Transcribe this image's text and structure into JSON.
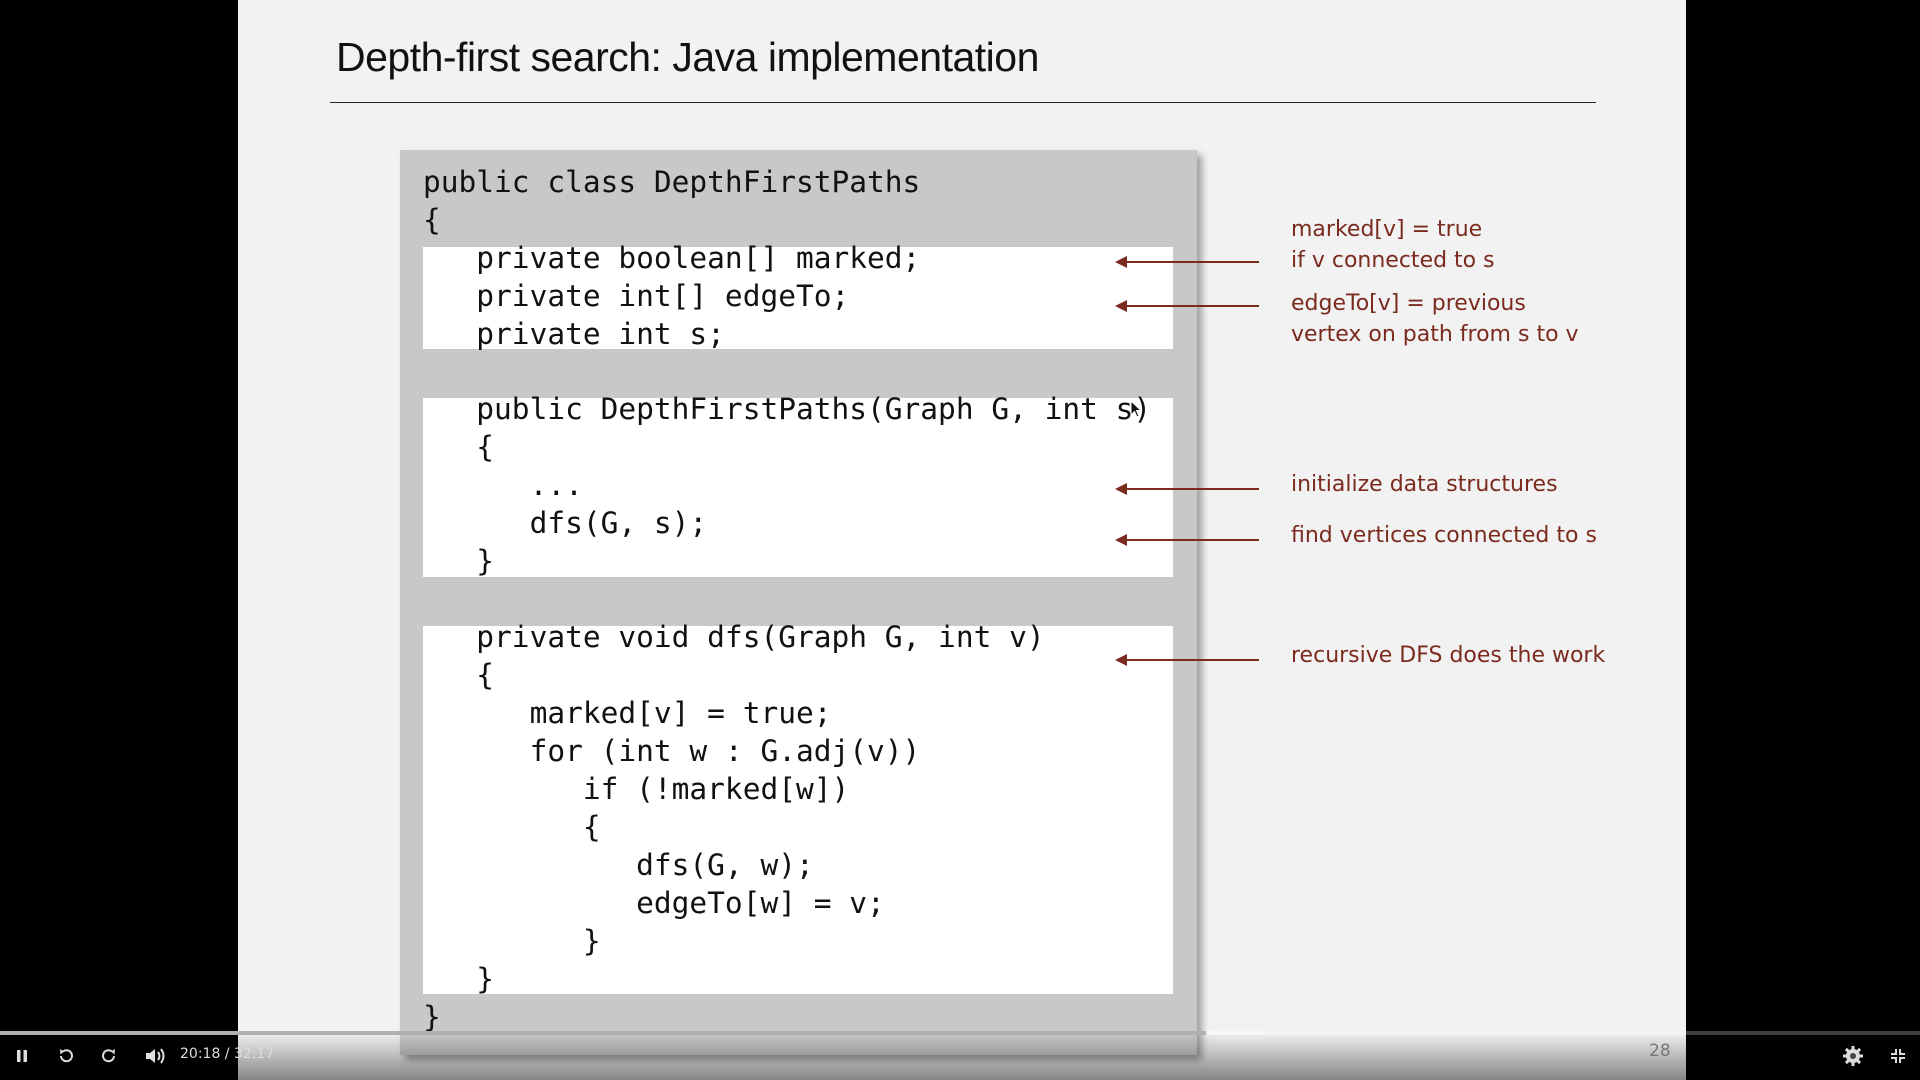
{
  "slide": {
    "title": "Depth-first search:  Java implementation",
    "page_number": "28"
  },
  "code": {
    "lines": [
      "public class DepthFirstPaths",
      "{",
      "   private boolean[] marked;",
      "   private int[] edgeTo;",
      "   private int s;",
      "   public DepthFirstPaths(Graph G, int s)",
      "   {",
      "      ...",
      "      dfs(G, s);",
      "   }",
      "   private void dfs(Graph G, int v)",
      "   {",
      "      marked[v] = true;",
      "      for (int w : G.adj(v))",
      "         if (!marked[w])",
      "         {",
      "            dfs(G, w);",
      "            edgeTo[w] = v;",
      "         }",
      "   }",
      "}"
    ]
  },
  "annotations": {
    "marked_1": "marked[v] = true",
    "marked_2": "if v connected to s",
    "edgeto_1": "edgeTo[v] = previous",
    "edgeto_2": "vertex on path from s to v",
    "init": "initialize data structures",
    "find": "find vertices connected to s",
    "recursive": "recursive DFS does the work"
  },
  "player": {
    "time": "20:18 / 32:17",
    "progress": 0.628,
    "buffered": 0.66
  },
  "colors": {
    "annotation": "#7b2a1e",
    "slide_bg": "#f2f2f2",
    "code_bg": "#c8c8c8"
  }
}
